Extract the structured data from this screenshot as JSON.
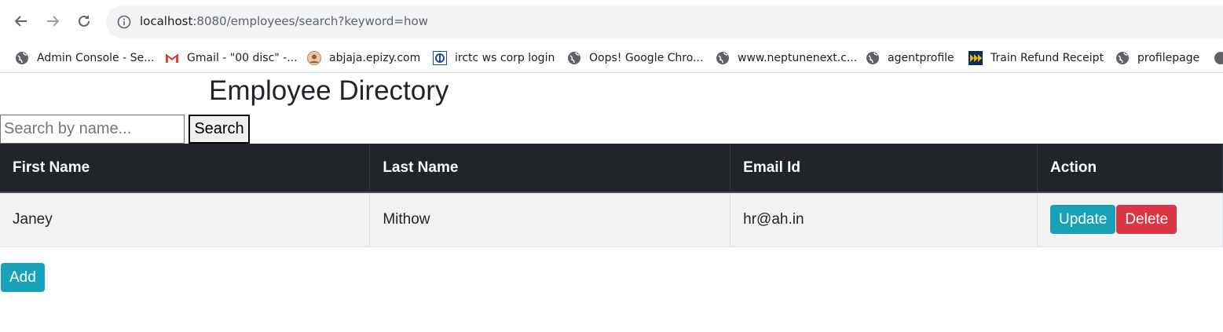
{
  "browser": {
    "url_host": "localhost",
    "url_rest": ":8080/employees/search?keyword=how",
    "bookmarks": [
      {
        "label": "Admin Console - Se...",
        "icon": "globe-icon"
      },
      {
        "label": "Gmail - \"00 disc\" -...",
        "icon": "gmail-icon"
      },
      {
        "label": "abjaja.epizy.com",
        "icon": "avatar-icon"
      },
      {
        "label": "irctc ws corp login",
        "icon": "irctc-icon"
      },
      {
        "label": "Oops! Google Chro...",
        "icon": "globe-icon"
      },
      {
        "label": "www.neptunenext.c...",
        "icon": "globe-icon"
      },
      {
        "label": "agentprofile",
        "icon": "globe-icon"
      },
      {
        "label": "Train Refund Receipt",
        "icon": "train-icon"
      },
      {
        "label": "profilepage",
        "icon": "globe-icon"
      }
    ]
  },
  "page": {
    "title": "Employee Directory",
    "search_placeholder": "Search by name...",
    "search_label": "Search",
    "table": {
      "headers": [
        "First Name",
        "Last Name",
        "Email Id",
        "Action"
      ],
      "rows": [
        {
          "first_name": "Janey",
          "last_name": "Mithow",
          "email": "hr@ah.in"
        }
      ]
    },
    "update_label": "Update",
    "delete_label": "Delete",
    "add_label": "Add"
  },
  "colors": {
    "header_bg": "#212529",
    "info": "#17a2b8",
    "danger": "#dc3545"
  }
}
